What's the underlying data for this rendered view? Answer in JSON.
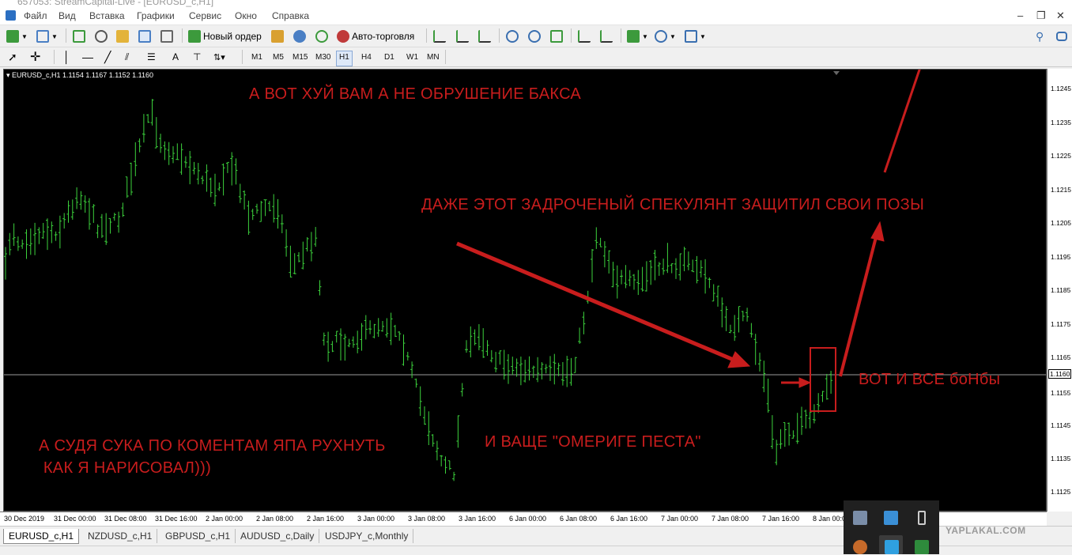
{
  "window": {
    "title": "657053: StreamCapital-Live - [EURUSD_c,H1]"
  },
  "menu": [
    "Файл",
    "Вид",
    "Вставка",
    "Графики",
    "Сервис",
    "Окно",
    "Справка"
  ],
  "toolbar": {
    "new_order_label": "Новый ордер",
    "autotrading_label": "Авто-торговля",
    "timeframes": [
      "M1",
      "M5",
      "M15",
      "M30",
      "H1",
      "H4",
      "D1",
      "W1",
      "MN"
    ],
    "active_timeframe": "H1"
  },
  "chart": {
    "header": "EURUSD_c,H1  1.1154 1.1167 1.1152 1.1160",
    "current_price_label": "1.1160",
    "price_labels": [
      "1.1245",
      "1.1235",
      "1.1225",
      "1.1215",
      "1.1205",
      "1.1195",
      "1.1185",
      "1.1175",
      "1.1165",
      "1.1155",
      "1.1145",
      "1.1135",
      "1.1125"
    ],
    "time_labels": [
      "30 Dec 2019",
      "31 Dec 00:00",
      "31 Dec 08:00",
      "31 Dec 16:00",
      "2 Jan 00:00",
      "2 Jan 08:00",
      "2 Jan 16:00",
      "3 Jan 00:00",
      "3 Jan 08:00",
      "3 Jan 16:00",
      "6 Jan 00:00",
      "6 Jan 08:00",
      "6 Jan 16:00",
      "7 Jan 00:00",
      "7 Jan 08:00",
      "7 Jan 16:00",
      "8 Jan 00:00"
    ],
    "colors": {
      "background": "#000000",
      "bars": "#3cd23c",
      "annotation": "#c81d1d",
      "bid_line": "#9a9a9a"
    },
    "annotations": {
      "top": "А ВОТ ХУЙ ВАМ А НЕ ОБРУШЕНИЕ БАКСА",
      "middle": "ДАЖЕ ЭТОТ ЗАДРОЧЕНЫЙ СПЕКУЛЯНТ ЗАЩИТИЛ СВОИ ПОЗЫ",
      "right": "ВОТ И ВСЕ боНбы",
      "bottom_left": "А СУДЯ СУКА ПО КОМЕНТАМ ЯПА РУХНУТЬ\n КАК Я НАРИСОВАЛ)))",
      "bottom_center": "И ВАЩЕ \"ОМЕРИГЕ ПЕСТА\""
    }
  },
  "tabs": [
    "EURUSD_c,H1",
    "NZDUSD_c,H1",
    "GBPUSD_c,H1",
    "AUDUSD_c,Daily",
    "USDJPY_c,Monthly"
  ],
  "active_tab": "EURUSD_c,H1",
  "watermark": "YAPLAKAL.COM"
}
